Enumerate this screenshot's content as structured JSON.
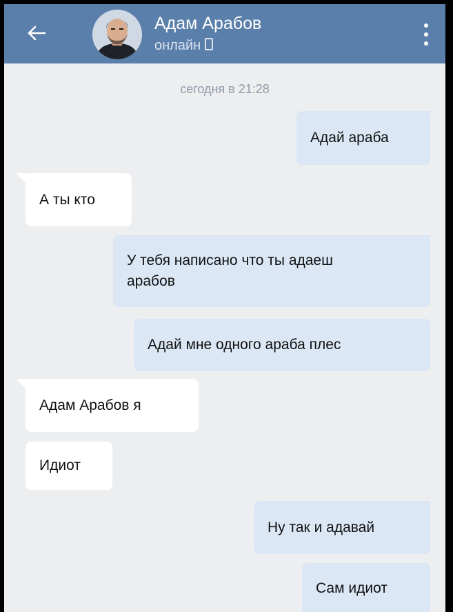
{
  "header": {
    "back_icon": "arrow-left-icon",
    "name": "Адам Арабов",
    "status": "онлайн",
    "status_icon": "mobile-phone-icon",
    "menu_icon": "more-vertical-icon",
    "background": "#5b7fab"
  },
  "date_separator": "сегодня в 21:28",
  "messages": [
    {
      "direction": "out",
      "text": "Адай араба"
    },
    {
      "direction": "in",
      "text": "А ты кто"
    },
    {
      "direction": "out",
      "text": "У тебя написано что ты адаеш\nарабов"
    },
    {
      "direction": "out",
      "text": "Адай мне одного араба плес"
    },
    {
      "direction": "in",
      "text": "Адам Арабов я"
    },
    {
      "direction": "in",
      "text": "Идиот"
    },
    {
      "direction": "out",
      "text": "Ну так и адавай"
    },
    {
      "direction": "out",
      "text": "Сам идиот"
    }
  ],
  "colors": {
    "outgoing_bubble": "#dbe7f5",
    "incoming_bubble": "#ffffff",
    "chat_background": "#edeef0"
  }
}
